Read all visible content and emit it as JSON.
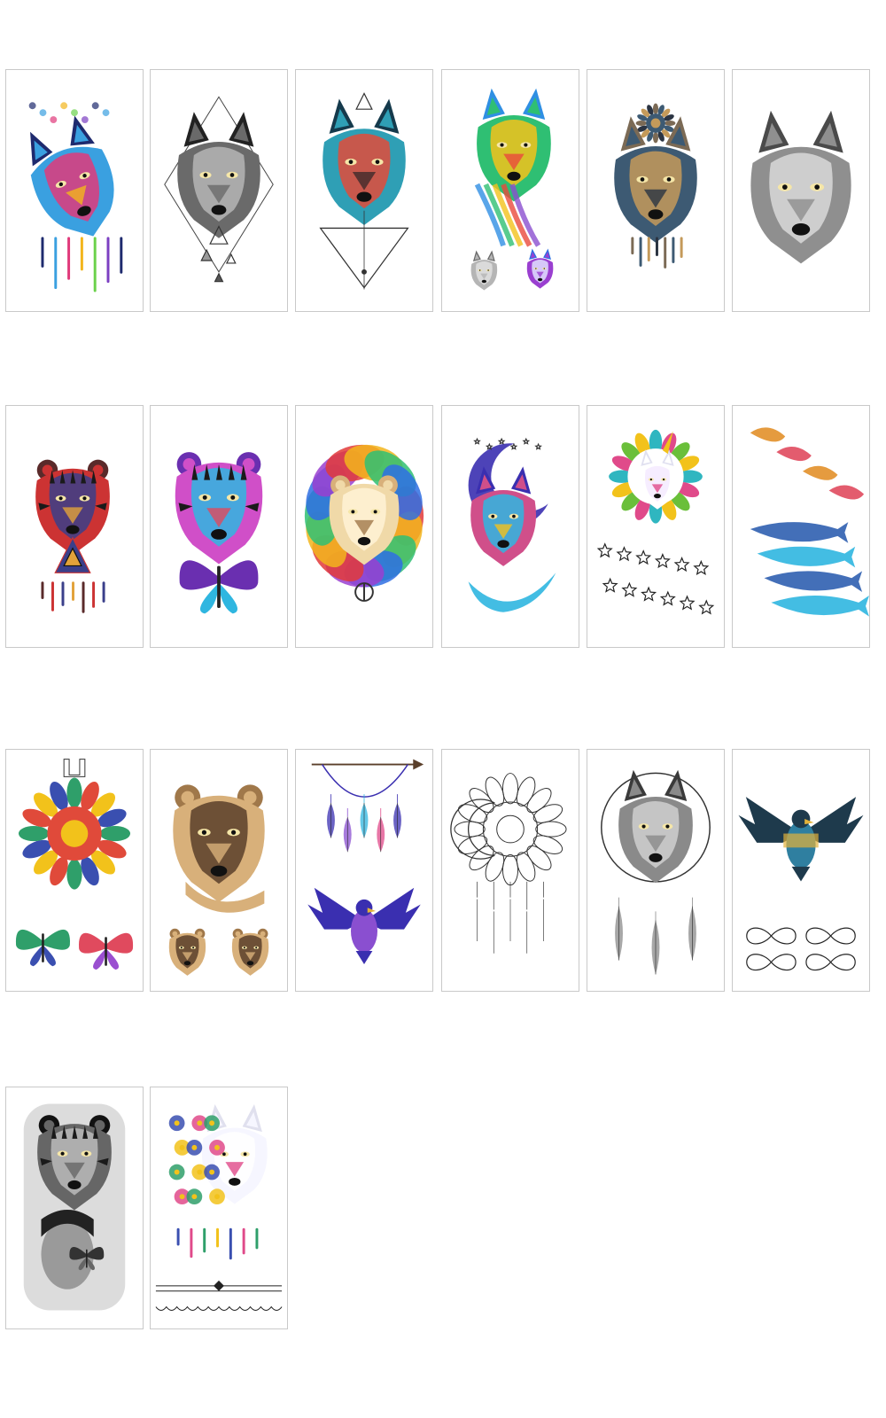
{
  "grid": {
    "items": [
      {
        "subject": "howling-wolf",
        "style": "watercolor",
        "palette": [
          "#1e2a6e",
          "#3aa0e0",
          "#e0397a",
          "#f2b51c",
          "#6bd14b",
          "#7c3fc2"
        ],
        "motifs": [
          "paint-drips"
        ]
      },
      {
        "subject": "wolf",
        "style": "geometric-sketch",
        "palette": [
          "#222222",
          "#6a6a6a",
          "#b5b5b5"
        ],
        "motifs": [
          "triangles",
          "diamond-frame"
        ]
      },
      {
        "subject": "wolf",
        "style": "geometric-color",
        "palette": [
          "#153a4c",
          "#2f9fb5",
          "#e24b3a",
          "#3e2a2a"
        ],
        "motifs": [
          "triangle-below"
        ]
      },
      {
        "subject": "wolf",
        "style": "rainbow-watercolor",
        "palette": [
          "#2f8fe3",
          "#2fbf73",
          "#f2c21b",
          "#ea4a3c",
          "#8b4fd0"
        ],
        "motifs": [
          "two-small-wolves"
        ]
      },
      {
        "subject": "wolf",
        "style": "ornamental",
        "palette": [
          "#7b6a55",
          "#3d5a73",
          "#c49a5a",
          "#2b3442"
        ],
        "motifs": [
          "mandala-crown"
        ]
      },
      {
        "subject": "wolf",
        "style": "realistic-grey",
        "palette": [
          "#4a4a4a",
          "#8f8f8f",
          "#d9d9d9"
        ],
        "motifs": []
      },
      {
        "subject": "tiger",
        "style": "tribal-color",
        "palette": [
          "#5a2a2a",
          "#c33",
          "#3a3f8a",
          "#e2a23a"
        ],
        "motifs": [
          "triangle-shapes",
          "drips"
        ]
      },
      {
        "subject": "tiger",
        "style": "neon-watercolor",
        "palette": [
          "#6a2fb0",
          "#d04fc8",
          "#2fb6e0",
          "#e04a5e"
        ],
        "motifs": [
          "butterfly"
        ]
      },
      {
        "subject": "lion",
        "style": "rainbow-mane",
        "palette": [
          "#e23a3a",
          "#f2b51c",
          "#2fbf73",
          "#2f6fe3",
          "#9a3fd0"
        ],
        "motifs": [
          "peace-sign-pendant"
        ]
      },
      {
        "subject": "wolf-and-moon",
        "style": "galaxy",
        "palette": [
          "#3a2fb0",
          "#d04f8a",
          "#2fb6e0",
          "#f2c21b"
        ],
        "motifs": [
          "crescent-moon",
          "stars"
        ]
      },
      {
        "subject": "unicorn",
        "style": "mandala-circle",
        "palette": [
          "#2fb6c0",
          "#e04a8a",
          "#6abf3a",
          "#f2c21b"
        ],
        "motifs": [
          "star-chain"
        ]
      },
      {
        "subject": "foxes-and-whales",
        "style": "watercolor",
        "palette": [
          "#e2902a",
          "#e04a5e",
          "#2f5fb0",
          "#2fb6e0"
        ],
        "motifs": [
          "leaping-foxes",
          "whale-pod"
        ]
      },
      {
        "subject": "hamsa-mandala",
        "style": "colorful-ornamental",
        "palette": [
          "#2f9f6a",
          "#e04a3a",
          "#f2c21b",
          "#3a4fb0"
        ],
        "motifs": [
          "butterflies"
        ]
      },
      {
        "subject": "lioness",
        "style": "realistic-color",
        "palette": [
          "#a0784a",
          "#d8b07a",
          "#5a3f2a"
        ],
        "motifs": [
          "two-cubs"
        ]
      },
      {
        "subject": "dreamcatcher-eagle",
        "style": "galaxy-watercolor",
        "palette": [
          "#3a2fb0",
          "#8a4fd0",
          "#2fb6e0",
          "#e04a8a"
        ],
        "motifs": [
          "arrow",
          "feathers",
          "eagle"
        ]
      },
      {
        "subject": "moon-dreamcatcher",
        "style": "linework",
        "palette": [
          "#222222",
          "#777777"
        ],
        "motifs": [
          "mandala",
          "feathers"
        ]
      },
      {
        "subject": "wolf-dreamcatcher",
        "style": "realistic-grey",
        "palette": [
          "#3a3a3a",
          "#8a8a8a",
          "#cfcfcf"
        ],
        "motifs": [
          "feathers"
        ]
      },
      {
        "subject": "eagle",
        "style": "double-exposure",
        "palette": [
          "#1e3a4c",
          "#2f7fa0",
          "#e2b23a"
        ],
        "motifs": [
          "infinity-symbols"
        ]
      },
      {
        "subject": "tiger-and-woman",
        "style": "blackwork-realism",
        "palette": [
          "#111111",
          "#666666",
          "#bbbbbb"
        ],
        "motifs": [
          "butterfly"
        ]
      },
      {
        "subject": "wolf-with-flowers",
        "style": "floral-watercolor",
        "palette": [
          "#3a4fb0",
          "#e04a8a",
          "#2f9f6a",
          "#f2c21b"
        ],
        "motifs": [
          "lace-border"
        ]
      }
    ]
  }
}
